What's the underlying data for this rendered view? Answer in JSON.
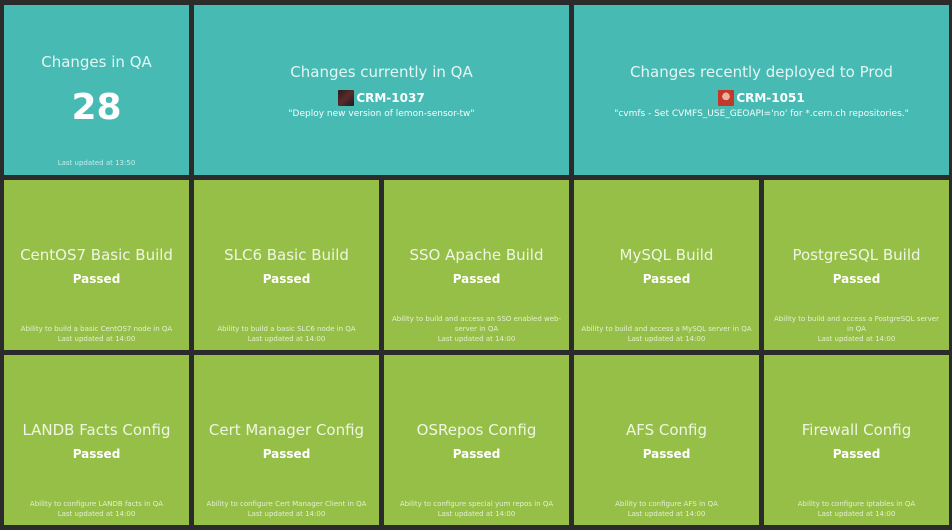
{
  "qa_count": {
    "title": "Changes in QA",
    "value": "28",
    "updated": "Last updated at 13:50"
  },
  "qa_current": {
    "title": "Changes currently in QA",
    "ticket": "CRM-1037",
    "description": "\"Deploy new version of lemon-sensor-tw\""
  },
  "prod_recent": {
    "title": "Changes recently deployed to Prod",
    "ticket": "CRM-1051",
    "description": "\"cvmfs - Set CVMFS_USE_GEOAPI='no' for *.cern.ch repositories.\""
  },
  "builds": [
    {
      "title": "CentOS7 Basic Build",
      "status": "Passed",
      "description": "Ability to build a basic CentOS7 node in QA",
      "updated": "Last updated at 14:00"
    },
    {
      "title": "SLC6 Basic Build",
      "status": "Passed",
      "description": "Ability to build a basic SLC6 node in QA",
      "updated": "Last updated at 14:00"
    },
    {
      "title": "SSO Apache Build",
      "status": "Passed",
      "description": "Ability to build and access an SSO enabled web-server in QA",
      "updated": "Last updated at 14:00"
    },
    {
      "title": "MySQL Build",
      "status": "Passed",
      "description": "Ability to build and access a MySQL server in QA",
      "updated": "Last updated at 14:00"
    },
    {
      "title": "PostgreSQL Build",
      "status": "Passed",
      "description": "Ability to build and access a PostgreSQL server in QA",
      "updated": "Last updated at 14:00"
    }
  ],
  "configs": [
    {
      "title": "LANDB Facts Config",
      "status": "Passed",
      "description": "Ability to configure LANDB facts in QA",
      "updated": "Last updated at 14:00"
    },
    {
      "title": "Cert Manager Config",
      "status": "Passed",
      "description": "Ability to configure Cert Manager Client in QA",
      "updated": "Last updated at 14:00"
    },
    {
      "title": "OSRepos Config",
      "status": "Passed",
      "description": "Ability to configure special yum repos in QA",
      "updated": "Last updated at 14:00"
    },
    {
      "title": "AFS Config",
      "status": "Passed",
      "description": "Ability to configure AFS in QA",
      "updated": "Last updated at 14:00"
    },
    {
      "title": "Firewall Config",
      "status": "Passed",
      "description": "Ability to configure iptables in QA",
      "updated": "Last updated at 14:00"
    }
  ],
  "colors": {
    "teal": "#47bbb3",
    "green": "#96bf48",
    "background": "#2b2b2b"
  },
  "icons": {
    "crm_1037_avatar": "user-avatar-icon",
    "crm_1051_avatar": "user-avatar-icon"
  }
}
